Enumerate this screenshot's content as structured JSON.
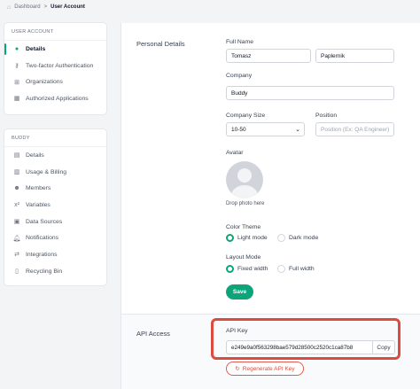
{
  "breadcrumb": {
    "home_icon": "home-icon",
    "parent": "Dashboard",
    "separator": ">",
    "current": "User Account"
  },
  "user_panel": {
    "header": "USER ACCOUNT",
    "items": [
      {
        "label": "Details",
        "icon": "user-icon",
        "active": true
      },
      {
        "label": "Two-factor Authentication",
        "icon": "key-icon",
        "active": false
      },
      {
        "label": "Organizations",
        "icon": "organization-icon",
        "active": false
      },
      {
        "label": "Authorized Applications",
        "icon": "apps-icon",
        "active": false
      }
    ]
  },
  "buddy_panel": {
    "header": "BUDDY",
    "items": [
      {
        "label": "Details",
        "icon": "document-icon"
      },
      {
        "label": "Usage & Billing",
        "icon": "chart-icon"
      },
      {
        "label": "Members",
        "icon": "members-icon"
      },
      {
        "label": "Variables",
        "icon": "variable-icon"
      },
      {
        "label": "Data Sources",
        "icon": "database-icon"
      },
      {
        "label": "Notifications",
        "icon": "bell-icon"
      },
      {
        "label": "Integrations",
        "icon": "integrations-icon"
      },
      {
        "label": "Recycling Bin",
        "icon": "trash-icon"
      }
    ]
  },
  "personal": {
    "title": "Personal Details",
    "full_name_label": "Full Name",
    "first_name": "Tomasz",
    "last_name": "Paplernik",
    "company_label": "Company",
    "company": "Buddy",
    "company_size_label": "Company Size",
    "company_size": "10-50",
    "position_label": "Position",
    "position_placeholder": "Position (Ex: QA Engineer)",
    "avatar_label": "Avatar",
    "drop_photo": "Drop photo here",
    "color_theme_label": "Color Theme",
    "light_mode": "Light mode",
    "dark_mode": "Dark mode",
    "color_theme_selected": "Light mode",
    "layout_mode_label": "Layout Mode",
    "fixed_width": "Fixed width",
    "full_width": "Full width",
    "layout_mode_selected": "Fixed width",
    "save": "Save"
  },
  "api": {
    "title": "API Access",
    "key_label": "API Key",
    "key_value": "e249e9a0f563298bae579d28500c2520c1ca87b8",
    "copy": "Copy",
    "regenerate": "Regenerate API Key",
    "regenerate_icon": "refresh-icon"
  },
  "colors": {
    "accent": "#0ea47a",
    "highlight": "#dc4c3e",
    "danger": "#dc4c3e"
  }
}
